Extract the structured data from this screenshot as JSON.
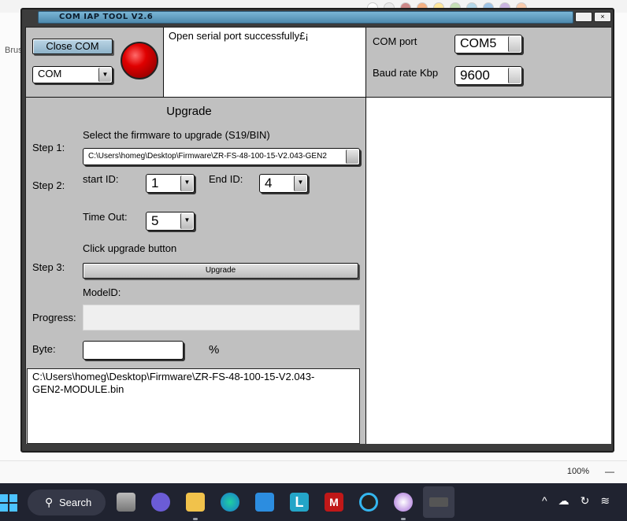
{
  "window": {
    "title": "COM IAP  TOOL V2.6",
    "close_glyph": "×"
  },
  "connection": {
    "close_com_label": "Close COM",
    "com_select_value": "COM",
    "status_led_color": "#e00000",
    "status_message": "Open serial port successfully£¡"
  },
  "port": {
    "com_port_label": "COM port",
    "com_port_value": "COM5",
    "baud_label": "Baud rate Kbp",
    "baud_value": "9600"
  },
  "upgrade": {
    "title": "Upgrade",
    "step1_label": "Step 1:",
    "step1_hint": "Select the firmware  to upgrade (S19/BIN)",
    "firmware_path": "C:\\Users\\homeg\\Desktop\\Firmware\\ZR-FS-48-100-15-V2.043-GEN2",
    "step2_label": "Step 2:",
    "start_id_label": "start ID:",
    "start_id_value": "1",
    "end_id_label": "End ID:",
    "end_id_value": "4",
    "timeout_label": "Time Out:",
    "timeout_value": "5",
    "step3_hint": "Click upgrade button",
    "step3_label": "Step 3:",
    "upgrade_button_label": "Upgrade",
    "model_id_label": "ModelD:",
    "progress_label": "Progress:",
    "progress_value": 0,
    "byte_label": "Byte:",
    "byte_value": "",
    "percent_label": "%",
    "log_line1": "C:\\Users\\homeg\\Desktop\\Firmware\\ZR-FS-48-100-15-V2.043-",
    "log_line2": "GEN2-MODULE.bin"
  },
  "background_app": {
    "brush_label": "Brus",
    "zoom_level": "100%",
    "zoom_minus": "—"
  },
  "taskbar": {
    "search_label": "Search",
    "search_icon_glyph": "⚲",
    "lcut_letter": "L",
    "mcafee_letter": "M",
    "tray_chevron": "^"
  }
}
